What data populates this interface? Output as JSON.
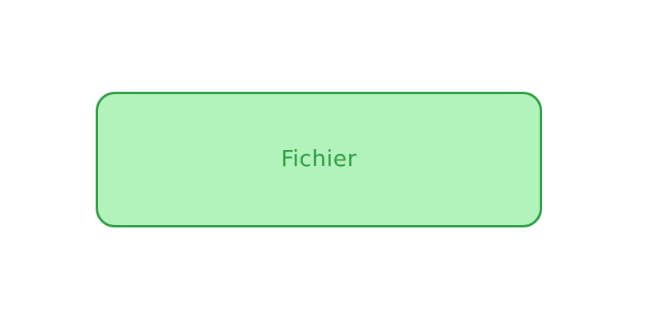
{
  "diagram": {
    "node": {
      "label": "Fichier",
      "fill_color": "#b2f2bb",
      "stroke_color": "#2f9e44",
      "text_color": "#2f9e44"
    }
  }
}
